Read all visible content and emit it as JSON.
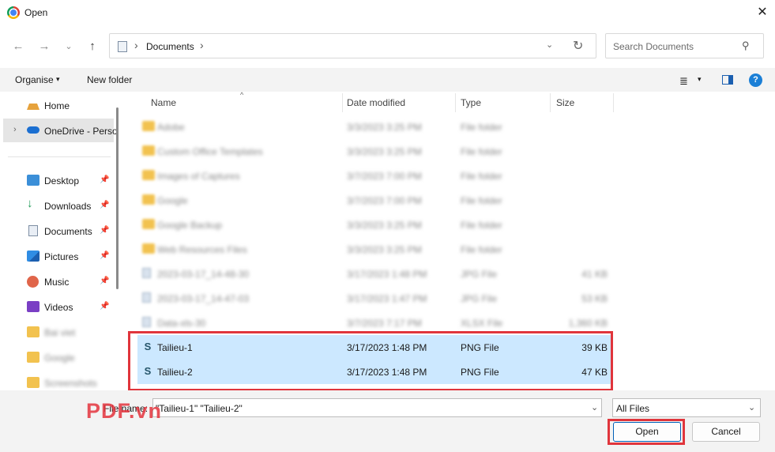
{
  "window": {
    "title": "Open",
    "close_glyph": "✕"
  },
  "nav": {
    "back": "←",
    "forward": "→",
    "recent": "⌄",
    "up": "↑",
    "address": {
      "sep": "›",
      "folder": "Documents",
      "dropdown": "⌄",
      "refresh": "↻"
    },
    "search": {
      "placeholder": "Search Documents",
      "icon": "⚲"
    }
  },
  "toolbar": {
    "organise": "Organise",
    "organise_caret": "▾",
    "new_folder": "New folder",
    "view_icon": "≣",
    "view_caret": "▾",
    "help": "?"
  },
  "sidebar": {
    "home": "Home",
    "onedrive": "OneDrive - Perso",
    "onedrive_chevron": "›",
    "pinned": [
      {
        "label": "Desktop"
      },
      {
        "label": "Downloads"
      },
      {
        "label": "Documents"
      },
      {
        "label": "Pictures"
      },
      {
        "label": "Music"
      },
      {
        "label": "Videos"
      }
    ],
    "pin_glyph": "📌",
    "blurred": [
      "Bai viet",
      "Google",
      "Screenshots"
    ]
  },
  "columns": {
    "name": "Name",
    "date": "Date modified",
    "type": "Type",
    "size": "Size",
    "sort_glyph": "^"
  },
  "files": [
    {
      "name": "Adobe",
      "date": "3/3/2023 3:25 PM",
      "type": "File folder",
      "size": "",
      "kind": "folder",
      "blurred": true
    },
    {
      "name": "Custom Office Templates",
      "date": "3/3/2023 3:25 PM",
      "type": "File folder",
      "size": "",
      "kind": "folder",
      "blurred": true
    },
    {
      "name": "Images of Captures",
      "date": "3/7/2023 7:00 PM",
      "type": "File folder",
      "size": "",
      "kind": "folder",
      "blurred": true
    },
    {
      "name": "Google",
      "date": "3/7/2023 7:00 PM",
      "type": "File folder",
      "size": "",
      "kind": "folder",
      "blurred": true
    },
    {
      "name": "Google Backup",
      "date": "3/3/2023 3:25 PM",
      "type": "File folder",
      "size": "",
      "kind": "folder",
      "blurred": true
    },
    {
      "name": "Web Resources Files",
      "date": "3/3/2023 3:25 PM",
      "type": "File folder",
      "size": "",
      "kind": "folder",
      "blurred": true
    },
    {
      "name": "2023-03-17_14-48-30",
      "date": "3/17/2023 1:48 PM",
      "type": "JPG File",
      "size": "41 KB",
      "kind": "image",
      "blurred": true
    },
    {
      "name": "2023-03-17_14-47-03",
      "date": "3/17/2023 1:47 PM",
      "type": "JPG File",
      "size": "53 KB",
      "kind": "image",
      "blurred": true
    },
    {
      "name": "Data-xls-30",
      "date": "3/7/2023 7:17 PM",
      "type": "XLSX File",
      "size": "1,360 KB",
      "kind": "doc",
      "blurred": true
    },
    {
      "name": "Tailieu-1",
      "date": "3/17/2023 1:48 PM",
      "type": "PNG File",
      "size": "39 KB",
      "kind": "s",
      "blurred": false,
      "selected": true
    },
    {
      "name": "Tailieu-2",
      "date": "3/17/2023 1:48 PM",
      "type": "PNG File",
      "size": "47 KB",
      "kind": "s",
      "blurred": false,
      "selected": true
    }
  ],
  "file_glyph": "S",
  "footer": {
    "file_name_label": "File name:",
    "file_name_value": "\"Tailieu-1\" \"Tailieu-2\"",
    "file_type": "All Files",
    "caret": "⌄",
    "open": "Open",
    "cancel": "Cancel"
  },
  "watermark": "PDF.vn",
  "colors": {
    "highlight": "#e0353c",
    "selection": "#cce8ff",
    "accent": "#005fb8"
  }
}
